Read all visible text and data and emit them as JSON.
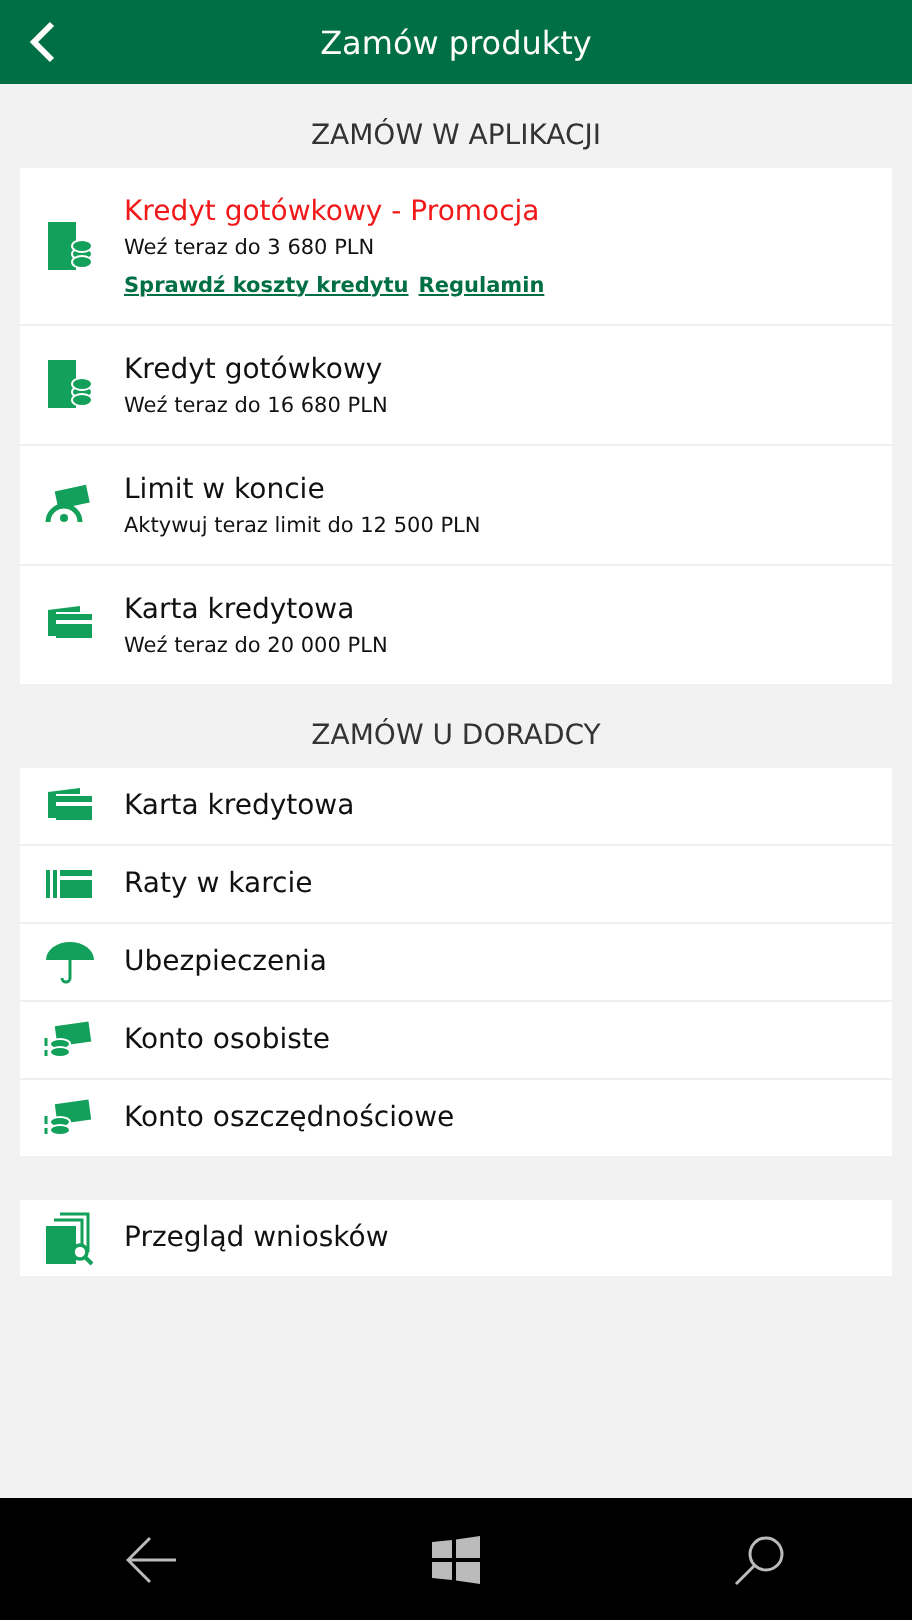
{
  "header": {
    "title": "Zamów produkty"
  },
  "sections": [
    {
      "heading": "ZAMÓW W APLIKACJI",
      "items": [
        {
          "kind": "loan",
          "title": "Kredyt gotówkowy - Promocja",
          "highlighted": true,
          "subtitle": "Weź teraz do 3 680 PLN",
          "links": [
            "Sprawdź koszty kredytu",
            "Regulamin"
          ]
        },
        {
          "kind": "loan",
          "title": "Kredyt gotówkowy",
          "highlighted": false,
          "subtitle": "Weź teraz do 16 680 PLN"
        },
        {
          "kind": "overdraft",
          "title": "Limit w koncie",
          "highlighted": false,
          "subtitle": "Aktywuj teraz limit do 12 500 PLN"
        },
        {
          "kind": "card",
          "title": "Karta kredytowa",
          "highlighted": false,
          "subtitle": "Weź teraz do 20 000 PLN"
        }
      ]
    },
    {
      "heading": "ZAMÓW U DORADCY",
      "items": [
        {
          "kind": "card",
          "title": "Karta kredytowa",
          "highlighted": false
        },
        {
          "kind": "installments",
          "title": "Raty w karcie",
          "highlighted": false
        },
        {
          "kind": "umbrella",
          "title": "Ubezpieczenia",
          "highlighted": false
        },
        {
          "kind": "account",
          "title": "Konto osobiste",
          "highlighted": false
        },
        {
          "kind": "account",
          "title": "Konto oszczędnościowe",
          "highlighted": false
        }
      ]
    },
    {
      "items": [
        {
          "kind": "review",
          "title": "Przegląd wniosków",
          "highlighted": false
        }
      ]
    }
  ]
}
